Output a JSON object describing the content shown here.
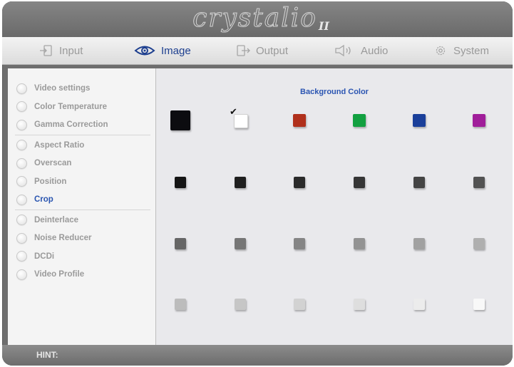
{
  "brand": {
    "logo": "crystalio",
    "logo_sub": "II"
  },
  "tabs": [
    {
      "label": "Input",
      "icon": "input-icon",
      "active": false
    },
    {
      "label": "Image",
      "icon": "eye-icon",
      "active": true
    },
    {
      "label": "Output",
      "icon": "output-icon",
      "active": false
    },
    {
      "label": "Audio",
      "icon": "speaker-icon",
      "active": false
    },
    {
      "label": "System",
      "icon": "gear-icon",
      "active": false
    }
  ],
  "sidebar": {
    "groups": [
      [
        "Video settings",
        "Color Temperature",
        "Gamma Correction"
      ],
      [
        "Aspect Ratio",
        "Overscan",
        "Position",
        "Crop"
      ],
      [
        "Deinterlace",
        "Noise Reducer",
        "DCDi",
        "Video Profile"
      ]
    ],
    "selected": "Crop"
  },
  "content": {
    "title": "Background Color",
    "selected_swatch": 1,
    "swatch_rows": [
      [
        "#0c0c10",
        "#ffffff",
        "#b0301c",
        "#12a040",
        "#1a3f9a",
        "#a01e9a"
      ],
      [
        "#151515",
        "#1f1f1f",
        "#2a2a2a",
        "#363636",
        "#444444",
        "#525252"
      ],
      [
        "#666666",
        "#767676",
        "#858585",
        "#939393",
        "#a1a1a1",
        "#afafaf"
      ],
      [
        "#bcbcbc",
        "#c6c6c6",
        "#d2d2d2",
        "#dedede",
        "#ececec",
        "#f8f8f8"
      ]
    ]
  },
  "hint": {
    "label": "HINT:"
  }
}
